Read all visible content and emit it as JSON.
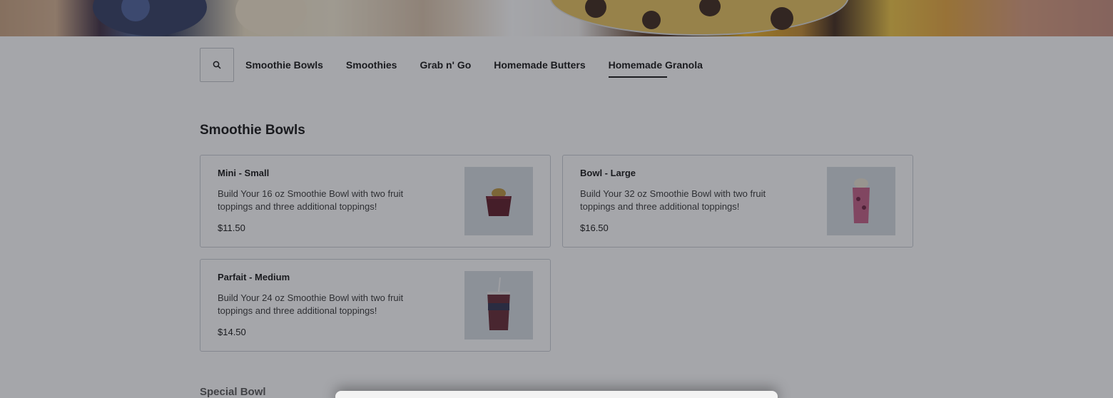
{
  "nav": {
    "search_icon": "search-icon",
    "tabs": [
      {
        "label": "Smoothie Bowls"
      },
      {
        "label": "Smoothies"
      },
      {
        "label": "Grab n' Go"
      },
      {
        "label": "Homemade Butters"
      },
      {
        "label": "Homemade Granola",
        "active": true
      }
    ]
  },
  "sections": {
    "smoothie_bowls": {
      "title": "Smoothie Bowls",
      "items": [
        {
          "name": "Mini - Small",
          "description": "Build Your 16 oz Smoothie Bowl with two fruit toppings and three additional toppings!",
          "price": "$11.50"
        },
        {
          "name": "Bowl - Large",
          "description": "Build Your 32 oz Smoothie Bowl with two fruit toppings and three additional toppings!",
          "price": "$16.50"
        },
        {
          "name": "Parfait - Medium",
          "description": "Build Your 24 oz Smoothie Bowl with two fruit toppings and three additional toppings!",
          "price": "$14.50"
        }
      ]
    },
    "special_bowl": {
      "title": "Special Bowl"
    }
  },
  "colors": {
    "overlay": "#282c34",
    "accent": "#111111"
  }
}
